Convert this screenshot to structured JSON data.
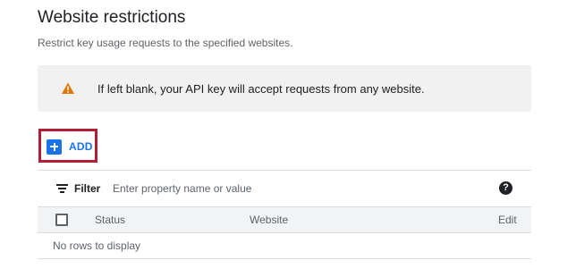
{
  "section": {
    "title": "Website restrictions",
    "subtitle": "Restrict key usage requests to the specified websites."
  },
  "warning": {
    "icon": "warning-icon",
    "text": "If left blank, your API key will accept requests from any website."
  },
  "add_button": {
    "icon": "plus-icon",
    "label": "ADD"
  },
  "filter": {
    "icon": "filter-icon",
    "label": "Filter",
    "placeholder": "Enter property name or value",
    "help_icon": "help-icon"
  },
  "table": {
    "columns": [
      "Status",
      "Website",
      "Edit"
    ],
    "empty_message": "No rows to display"
  },
  "colors": {
    "accent": "#1a73e8",
    "warning": "#e37400",
    "highlight": "#b71c37"
  }
}
